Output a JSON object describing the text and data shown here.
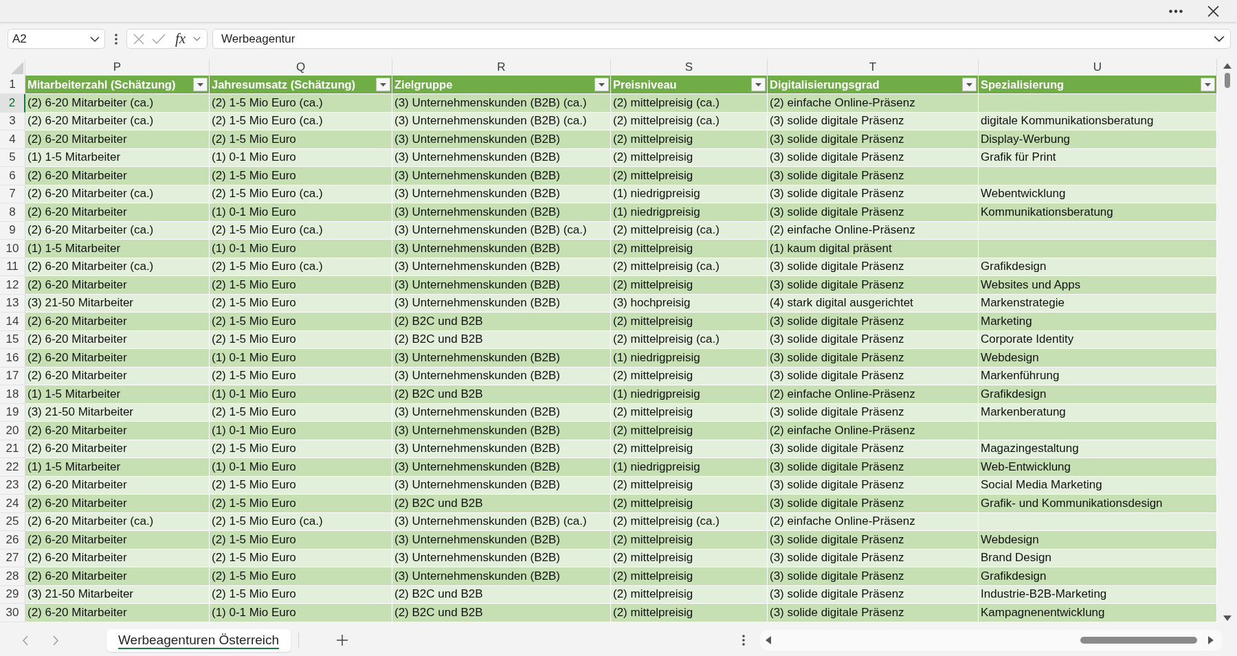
{
  "formula_bar": {
    "name_box": "A2",
    "function_label": "fx",
    "value": "Werbeagentur"
  },
  "table": {
    "header_row_number": "1",
    "columns": [
      {
        "letter": "P",
        "heading": "Mitarbeiterzahl (Schätzung)"
      },
      {
        "letter": "Q",
        "heading": "Jahresumsatz (Schätzung)"
      },
      {
        "letter": "R",
        "heading": "Zielgruppe"
      },
      {
        "letter": "S",
        "heading": "Preisniveau"
      },
      {
        "letter": "T",
        "heading": "Digitalisierungsgrad"
      },
      {
        "letter": "U",
        "heading": "Spezialisierung"
      }
    ],
    "rows": [
      {
        "number": "2",
        "selected": true,
        "employees": "(2) 6-20 Mitarbeiter (ca.)",
        "revenue": "(2) 1-5 Mio Euro (ca.)",
        "target_group": "(3) Unternehmenskunden (B2B) (ca.)",
        "price_level": "(2) mittelpreisig (ca.)",
        "digitalization": "(2) einfache Online-Präsenz"
      },
      {
        "number": "3",
        "selected": false,
        "employees": "(2) 6-20 Mitarbeiter (ca.)",
        "revenue": "(2) 1-5 Mio Euro (ca.)",
        "target_group": "(3) Unternehmenskunden (B2B) (ca.)",
        "price_level": "(2) mittelpreisig (ca.)",
        "digitalization": "(3) solide digitale Präsenz",
        "specialization": "digitale Kommunikationsberatung"
      },
      {
        "number": "4",
        "selected": false,
        "employees": "(2) 6-20 Mitarbeiter",
        "revenue": "(2) 1-5 Mio Euro",
        "target_group": "(3) Unternehmenskunden (B2B)",
        "price_level": "(2) mittelpreisig",
        "digitalization": "(3) solide digitale Präsenz",
        "specialization": "Display-Werbung"
      },
      {
        "number": "5",
        "selected": false,
        "employees": "(1) 1-5 Mitarbeiter",
        "revenue": "(1) 0-1 Mio Euro",
        "target_group": "(3) Unternehmenskunden (B2B)",
        "price_level": "(2) mittelpreisig",
        "digitalization": "(3) solide digitale Präsenz",
        "specialization": "Grafik für Print"
      },
      {
        "number": "6",
        "selected": false,
        "employees": "(2) 6-20 Mitarbeiter",
        "revenue": "(2) 1-5 Mio Euro",
        "target_group": "(3) Unternehmenskunden (B2B)",
        "price_level": "(2) mittelpreisig",
        "digitalization": "(3) solide digitale Präsenz"
      },
      {
        "number": "7",
        "selected": false,
        "employees": "(2) 6-20 Mitarbeiter (ca.)",
        "revenue": "(2) 1-5 Mio Euro (ca.)",
        "target_group": "(3) Unternehmenskunden (B2B)",
        "price_level": "(1) niedrigpreisig",
        "digitalization": "(3) solide digitale Präsenz",
        "specialization": "Webentwicklung"
      },
      {
        "number": "8",
        "selected": false,
        "employees": "(2) 6-20 Mitarbeiter",
        "revenue": "(1) 0-1 Mio Euro",
        "target_group": "(3) Unternehmenskunden (B2B)",
        "price_level": "(1) niedrigpreisig",
        "digitalization": "(3) solide digitale Präsenz",
        "specialization": "Kommunikationsberatung"
      },
      {
        "number": "9",
        "selected": false,
        "employees": "(2) 6-20 Mitarbeiter (ca.)",
        "revenue": "(2) 1-5 Mio Euro (ca.)",
        "target_group": "(3) Unternehmenskunden (B2B) (ca.)",
        "price_level": "(2) mittelpreisig (ca.)",
        "digitalization": "(2) einfache Online-Präsenz"
      },
      {
        "number": "10",
        "selected": false,
        "employees": "(1) 1-5 Mitarbeiter",
        "revenue": "(1) 0-1 Mio Euro",
        "target_group": "(3) Unternehmenskunden (B2B)",
        "price_level": "(2) mittelpreisig",
        "digitalization": "(1) kaum digital präsent"
      },
      {
        "number": "11",
        "selected": false,
        "employees": "(2) 6-20 Mitarbeiter (ca.)",
        "revenue": "(2) 1-5 Mio Euro (ca.)",
        "target_group": "(3) Unternehmenskunden (B2B)",
        "price_level": "(2) mittelpreisig (ca.)",
        "digitalization": "(3) solide digitale Präsenz",
        "specialization": "Grafikdesign"
      },
      {
        "number": "12",
        "selected": false,
        "employees": "(2) 6-20 Mitarbeiter",
        "revenue": "(2) 1-5 Mio Euro",
        "target_group": "(3) Unternehmenskunden (B2B)",
        "price_level": "(2) mittelpreisig",
        "digitalization": "(3) solide digitale Präsenz",
        "specialization": "Websites und Apps"
      },
      {
        "number": "13",
        "selected": false,
        "employees": "(3) 21-50 Mitarbeiter",
        "revenue": "(2) 1-5 Mio Euro",
        "target_group": "(3) Unternehmenskunden (B2B)",
        "price_level": "(3) hochpreisig",
        "digitalization": "(4) stark digital ausgerichtet",
        "specialization": "Markenstrategie"
      },
      {
        "number": "14",
        "selected": false,
        "employees": "(2) 6-20 Mitarbeiter",
        "revenue": "(2) 1-5 Mio Euro",
        "target_group": "(2) B2C und B2B",
        "price_level": "(2) mittelpreisig",
        "digitalization": "(3) solide digitale Präsenz",
        "specialization": "Marketing"
      },
      {
        "number": "15",
        "selected": false,
        "employees": "(2) 6-20 Mitarbeiter",
        "revenue": "(2) 1-5 Mio Euro",
        "target_group": "(2) B2C und B2B",
        "price_level": "(2) mittelpreisig (ca.)",
        "digitalization": "(3) solide digitale Präsenz",
        "specialization": "Corporate Identity"
      },
      {
        "number": "16",
        "selected": false,
        "employees": "(2) 6-20 Mitarbeiter",
        "revenue": "(1) 0-1 Mio Euro",
        "target_group": "(3) Unternehmenskunden (B2B)",
        "price_level": "(1) niedrigpreisig",
        "digitalization": "(3) solide digitale Präsenz",
        "specialization": "Webdesign"
      },
      {
        "number": "17",
        "selected": false,
        "employees": "(2) 6-20 Mitarbeiter",
        "revenue": "(2) 1-5 Mio Euro",
        "target_group": "(3) Unternehmenskunden (B2B)",
        "price_level": "(2) mittelpreisig",
        "digitalization": "(3) solide digitale Präsenz",
        "specialization": "Markenführung"
      },
      {
        "number": "18",
        "selected": false,
        "employees": "(1) 1-5 Mitarbeiter",
        "revenue": "(1) 0-1 Mio Euro",
        "target_group": "(2) B2C und B2B",
        "price_level": "(1) niedrigpreisig",
        "digitalization": "(2) einfache Online-Präsenz",
        "specialization": "Grafikdesign"
      },
      {
        "number": "19",
        "selected": false,
        "employees": "(3) 21-50 Mitarbeiter",
        "revenue": "(2) 1-5 Mio Euro",
        "target_group": "(3) Unternehmenskunden (B2B)",
        "price_level": "(2) mittelpreisig",
        "digitalization": "(3) solide digitale Präsenz",
        "specialization": "Markenberatung"
      },
      {
        "number": "20",
        "selected": false,
        "employees": "(2) 6-20 Mitarbeiter",
        "revenue": "(1) 0-1 Mio Euro",
        "target_group": "(3) Unternehmenskunden (B2B)",
        "price_level": "(2) mittelpreisig",
        "digitalization": "(2) einfache Online-Präsenz"
      },
      {
        "number": "21",
        "selected": false,
        "employees": "(2) 6-20 Mitarbeiter",
        "revenue": "(2) 1-5 Mio Euro",
        "target_group": "(3) Unternehmenskunden (B2B)",
        "price_level": "(2) mittelpreisig",
        "digitalization": "(3) solide digitale Präsenz",
        "specialization": "Magazingestaltung"
      },
      {
        "number": "22",
        "selected": false,
        "employees": "(1) 1-5 Mitarbeiter",
        "revenue": "(1) 0-1 Mio Euro",
        "target_group": "(3) Unternehmenskunden (B2B)",
        "price_level": "(1) niedrigpreisig",
        "digitalization": "(3) solide digitale Präsenz",
        "specialization": "Web-Entwicklung"
      },
      {
        "number": "23",
        "selected": false,
        "employees": "(2) 6-20 Mitarbeiter",
        "revenue": "(2) 1-5 Mio Euro",
        "target_group": "(3) Unternehmenskunden (B2B)",
        "price_level": "(2) mittelpreisig",
        "digitalization": "(3) solide digitale Präsenz",
        "specialization": "Social Media Marketing"
      },
      {
        "number": "24",
        "selected": false,
        "employees": "(2) 6-20 Mitarbeiter",
        "revenue": "(2) 1-5 Mio Euro",
        "target_group": "(2) B2C und B2B",
        "price_level": "(2) mittelpreisig",
        "digitalization": "(3) solide digitale Präsenz",
        "specialization": "Grafik- und Kommunikationsdesign"
      },
      {
        "number": "25",
        "selected": false,
        "employees": "(2) 6-20 Mitarbeiter (ca.)",
        "revenue": "(2) 1-5 Mio Euro (ca.)",
        "target_group": "(3) Unternehmenskunden (B2B) (ca.)",
        "price_level": "(2) mittelpreisig (ca.)",
        "digitalization": "(2) einfache Online-Präsenz"
      },
      {
        "number": "26",
        "selected": false,
        "employees": "(2) 6-20 Mitarbeiter",
        "revenue": "(2) 1-5 Mio Euro",
        "target_group": "(3) Unternehmenskunden (B2B)",
        "price_level": "(2) mittelpreisig",
        "digitalization": "(3) solide digitale Präsenz",
        "specialization": "Webdesign"
      },
      {
        "number": "27",
        "selected": false,
        "employees": "(2) 6-20 Mitarbeiter",
        "revenue": "(2) 1-5 Mio Euro",
        "target_group": "(3) Unternehmenskunden (B2B)",
        "price_level": "(2) mittelpreisig",
        "digitalization": "(3) solide digitale Präsenz",
        "specialization": "Brand Design"
      },
      {
        "number": "28",
        "selected": false,
        "employees": "(2) 6-20 Mitarbeiter",
        "revenue": "(2) 1-5 Mio Euro",
        "target_group": "(3) Unternehmenskunden (B2B)",
        "price_level": "(2) mittelpreisig",
        "digitalization": "(3) solide digitale Präsenz",
        "specialization": "Grafikdesign"
      },
      {
        "number": "29",
        "selected": false,
        "employees": "(3) 21-50 Mitarbeiter",
        "revenue": "(2) 1-5 Mio Euro",
        "target_group": "(2) B2C und B2B",
        "price_level": "(2) mittelpreisig",
        "digitalization": "(3) solide digitale Präsenz",
        "specialization": "Industrie-B2B-Marketing"
      },
      {
        "number": "30",
        "selected": false,
        "employees": "(2) 6-20 Mitarbeiter",
        "revenue": "(1) 0-1 Mio Euro",
        "target_group": "(2) B2C und B2B",
        "price_level": "(2) mittelpreisig",
        "digitalization": "(3) solide digitale Präsenz",
        "specialization": "Kampagnenentwicklung"
      }
    ]
  },
  "sheet_tabs": [
    {
      "label": "Werbeagenturen Österreich",
      "selected": true
    }
  ]
}
